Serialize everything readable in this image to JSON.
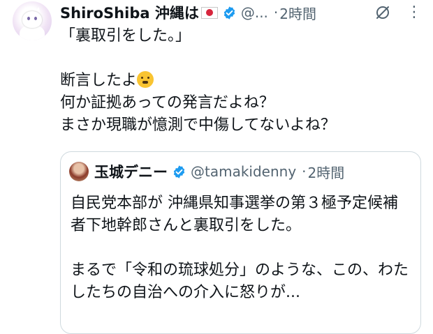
{
  "author": {
    "name": "ShiroShiba 沖縄は",
    "handle": "@...",
    "separator": "·",
    "time": "2時間"
  },
  "tweet": {
    "text": "「裏取引をした。」\n\n断言したよ",
    "text2": "\n何か証拠あっての発言だよね？\nまさか現職が憶測で中傷してないよね？"
  },
  "quoted": {
    "name": "玉城デニー",
    "handle": "@tamakidenny",
    "separator": "·",
    "time": "2時間",
    "text": "自民党本部が 沖縄県知事選挙の第３極予定候補者下地幹郎さんと裏取引をした。\n\nまるで「令和の琉球処分」のような、この、わたしたちの自治への介入に怒りが..."
  },
  "icons": {
    "verified": "verified-badge-icon",
    "grok": "grok-icon",
    "more": "more-options-icon",
    "flag": "japan-flag-emoji",
    "emoji": "shushing-face-emoji"
  },
  "colors": {
    "verified": "#1d9bf0",
    "secondary_text": "#536471",
    "border": "#cfd9de"
  }
}
